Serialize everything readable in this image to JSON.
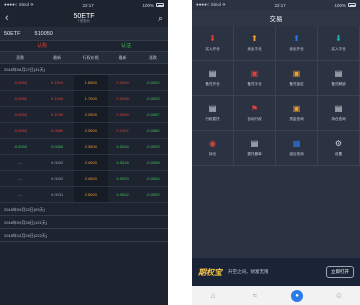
{
  "left": {
    "status": {
      "carrier": "●●●●○ Sinol ✈",
      "time": "22:17",
      "battery": "100%"
    },
    "nav": {
      "title": "50ETF",
      "subtitle": "T型报价"
    },
    "security": {
      "name": "50ETF",
      "code": "510050"
    },
    "legs": {
      "call": "认购",
      "put": "认沽"
    },
    "columns": [
      "涨跌",
      "最新",
      "行权价格",
      "最新",
      "涨跌"
    ],
    "section_open": "2018年06月27日(31天)",
    "rows": [
      {
        "c0": "-0.0060",
        "c1": "0.1510",
        "strike": "1.6500",
        "c3": "0.0049",
        "c4": "-0.0002",
        "cls": [
          "red",
          "red",
          "org",
          "red",
          "green"
        ]
      },
      {
        "c0": "-0.0080",
        "c1": "0.1430",
        "strike": "1.7000",
        "c3": "0.0048",
        "c4": "-0.0003",
        "cls": [
          "red",
          "red",
          "org",
          "red",
          "green"
        ]
      },
      {
        "c0": "-0.0050",
        "c1": "0.1030",
        "strike": "2.2500",
        "c3": "0.0090",
        "c4": "-0.0057",
        "cls": [
          "red",
          "red",
          "org",
          "red",
          "green"
        ]
      },
      {
        "c0": "-0.0060",
        "c1": "0.0680",
        "strike": "2.3000",
        "c3": "0.0157",
        "c4": "-0.0060",
        "cls": [
          "red",
          "red",
          "org",
          "red",
          "green"
        ]
      },
      {
        "c0": "-0.0050",
        "c1": "0.0360",
        "strike": "2.3500",
        "c3": "0.0034",
        "c4": "-0.0029",
        "cls": [
          "green",
          "green",
          "org",
          "green",
          "green"
        ]
      },
      {
        "c0": "---",
        "c1": "0.0032",
        "strike": "2.4000",
        "c3": "0.0016",
        "c4": "-0.0008",
        "cls": [
          "gray",
          "gray",
          "org",
          "green",
          "green"
        ]
      },
      {
        "c0": "---",
        "c1": "0.0032",
        "strike": "2.4500",
        "c3": "0.0003",
        "c4": "-0.0004",
        "cls": [
          "gray",
          "gray",
          "org",
          "green",
          "green"
        ]
      },
      {
        "c0": "---",
        "c1": "0.0031",
        "strike": "2.5000",
        "c3": "0.0002",
        "c4": "-0.0000",
        "cls": [
          "gray",
          "gray",
          "org",
          "green",
          "green"
        ]
      }
    ],
    "expiries": [
      "2018年09月22日(93天)",
      "2018年09月26日(121天)",
      "2018年12月26日(222天)"
    ]
  },
  "right": {
    "status": {
      "carrier": "●●●●○ Sinol ✈",
      "time": "22:17",
      "battery": "100%"
    },
    "nav": {
      "title": "交易"
    },
    "grid": [
      {
        "label": "买入开仓",
        "icon": "down-arrow-icon",
        "glyph": "⬇",
        "color": "#e2403a"
      },
      {
        "label": "卖出平仓",
        "icon": "up-arrow-icon",
        "glyph": "⬆",
        "color": "#f0a02c"
      },
      {
        "label": "卖出开仓",
        "icon": "up-arrow-icon",
        "glyph": "⬆",
        "color": "#2b7be8"
      },
      {
        "label": "买入平仓",
        "icon": "down-arrow-icon",
        "glyph": "⬇",
        "color": "#22b3b3"
      },
      {
        "label": "备兑开仓",
        "icon": "doc-icon",
        "glyph": "▤",
        "color": "#e8ecf1"
      },
      {
        "label": "备兑平仓",
        "icon": "lock-icon",
        "glyph": "▣",
        "color": "#e2403a"
      },
      {
        "label": "备兑锁定",
        "icon": "lock-icon",
        "glyph": "▣",
        "color": "#f0a02c"
      },
      {
        "label": "备兑解锁",
        "icon": "doc-icon",
        "glyph": "▤",
        "color": "#e8ecf1"
      },
      {
        "label": "行权委托",
        "icon": "doc-icon",
        "glyph": "▤",
        "color": "#e8ecf1"
      },
      {
        "label": "自动行权",
        "icon": "flag-icon",
        "glyph": "⚑",
        "color": "#e2403a"
      },
      {
        "label": "资金查询",
        "icon": "lock-icon",
        "glyph": "▣",
        "color": "#f0a02c"
      },
      {
        "label": "持仓查询",
        "icon": "doc-icon",
        "glyph": "▤",
        "color": "#e8ecf1"
      },
      {
        "label": "持仓",
        "icon": "holdings-icon",
        "glyph": "◉",
        "color": "#e2403a"
      },
      {
        "label": "委托撤单",
        "icon": "doc-icon",
        "glyph": "▤",
        "color": "#e8ecf1"
      },
      {
        "label": "组合查询",
        "icon": "grid-icon",
        "glyph": "▦",
        "color": "#2b7be8"
      },
      {
        "label": "设置",
        "icon": "gear-icon",
        "glyph": "⚙",
        "color": "#c9d0db"
      }
    ],
    "banner": {
      "logo": "期权宝",
      "slogan": "升空之间，财富无限",
      "button": "立即打开"
    },
    "tabs": [
      {
        "icon": "home-icon",
        "glyph": "⌂"
      },
      {
        "icon": "chart-icon",
        "glyph": "≈"
      },
      {
        "icon": "trade-icon",
        "glyph": "●"
      },
      {
        "icon": "user-icon",
        "glyph": "☺"
      }
    ]
  }
}
